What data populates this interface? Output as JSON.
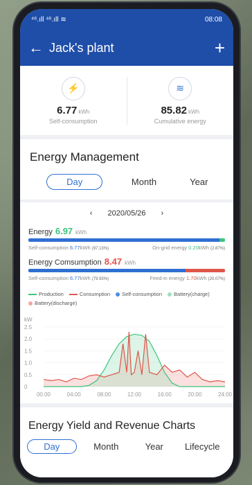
{
  "status": {
    "signal": "⁴⁶.ıll ⁴⁶.ıll ≋",
    "time": "08:08"
  },
  "header": {
    "title": "Jack's plant",
    "plus": "+"
  },
  "stats": [
    {
      "value": "6.77",
      "unit": "kWh",
      "label": "Self-consumption"
    },
    {
      "value": "85.82",
      "unit": "kWh",
      "label": "Cumulative energy"
    }
  ],
  "energy_management": {
    "title": "Energy Management",
    "tabs": [
      "Day",
      "Month",
      "Year"
    ],
    "date": "2020/05/26",
    "energy": {
      "label": "Energy",
      "value": "6.97",
      "unit": "kWh",
      "left_label": "Self-consumption",
      "left_value": "6.77",
      "left_unit": "kWh",
      "left_pct": "(97.13%)",
      "right_label": "On-grid energy",
      "right_value": "0.20",
      "right_unit": "kWh",
      "right_pct": "(2.87%)",
      "fraction": 0.9713
    },
    "consumption": {
      "label": "Energy Comsumption",
      "value": "8.47",
      "unit": "kWh",
      "left_label": "Self-consumption",
      "left_value": "6.77",
      "left_unit": "kWh",
      "left_pct": "(79.93%)",
      "right_label": "Feed-in energy",
      "right_value": "1.70",
      "right_unit": "kWh",
      "right_pct": "(20.07%)",
      "fraction": 0.7993
    },
    "legend": [
      "Production",
      "Consumption",
      "Self-consumption",
      "Battery(charge)",
      "Battery(discharge)"
    ],
    "colors": {
      "production": "#3cc47c",
      "consumption": "#e0554a",
      "self": "#4a8ee6",
      "charge": "#9ee0bd",
      "discharge": "#f2a7a0",
      "accent": "#2f6fd2"
    }
  },
  "chart_data": {
    "type": "area",
    "ylabel": "kW",
    "yticks": [
      "2.5",
      "2.0",
      "1.5",
      "1.0",
      "0.5",
      "0"
    ],
    "xticks": [
      "00:00",
      "04:00",
      "08:00",
      "12:00",
      "16:00",
      "20:00",
      "24:00"
    ],
    "ylim": [
      0,
      2.5
    ],
    "xlim": [
      0,
      24
    ],
    "series": [
      {
        "name": "Production",
        "x": [
          0,
          5,
          6,
          7,
          8,
          9,
          10,
          11,
          12,
          13,
          14,
          15,
          16,
          17,
          18,
          24
        ],
        "values": [
          0,
          0,
          0.05,
          0.25,
          0.7,
          1.3,
          1.8,
          2.1,
          2.2,
          2.15,
          1.9,
          1.3,
          0.6,
          0.15,
          0,
          0
        ]
      },
      {
        "name": "Consumption",
        "x": [
          0,
          1,
          2,
          3,
          4,
          5,
          6,
          7,
          8,
          9,
          10,
          10.5,
          11,
          11.3,
          11.6,
          12,
          12.5,
          13,
          13.5,
          14,
          15,
          16,
          17,
          18,
          19,
          20,
          21,
          22,
          23,
          24
        ],
        "values": [
          0.3,
          0.25,
          0.3,
          0.2,
          0.35,
          0.3,
          0.45,
          0.5,
          0.4,
          0.5,
          0.6,
          1.8,
          0.6,
          2.3,
          0.5,
          0.6,
          1.5,
          0.5,
          2.2,
          0.6,
          0.5,
          0.9,
          0.6,
          0.7,
          0.4,
          0.6,
          0.3,
          0.2,
          0.25,
          0.2
        ]
      }
    ]
  },
  "yield": {
    "title": "Energy Yield and Revenue Charts",
    "tabs": [
      "Day",
      "Month",
      "Year",
      "Lifecycle"
    ]
  }
}
